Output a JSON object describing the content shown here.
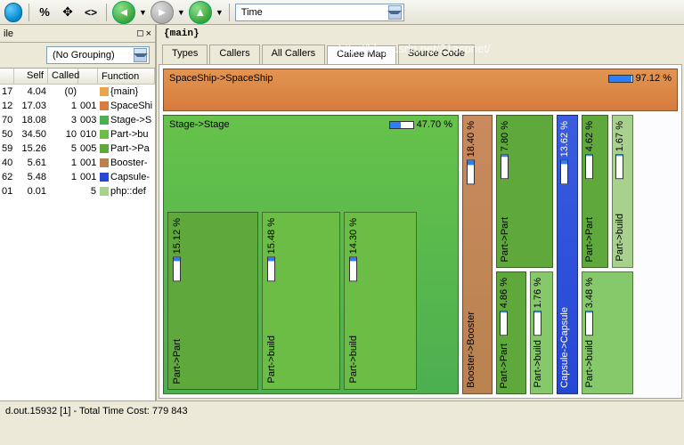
{
  "toolbar": {
    "combo_label": "Time"
  },
  "left": {
    "title": "ile",
    "grouping": "(No Grouping)",
    "headers": [
      "",
      "Self",
      "Called",
      "",
      "Function"
    ],
    "rows": [
      {
        "a": "17",
        "self": "4.04",
        "called": "(0)",
        "n": "",
        "color": "#e8a54a",
        "fn": "{main}"
      },
      {
        "a": "12",
        "self": "17.03",
        "called": "1",
        "n": "001",
        "color": "#d77b3f",
        "fn": "SpaceShi"
      },
      {
        "a": "70",
        "self": "18.08",
        "called": "3",
        "n": "003",
        "color": "#4caf50",
        "fn": "Stage->S"
      },
      {
        "a": "50",
        "self": "34.50",
        "called": "10",
        "n": "010",
        "color": "#6bbd45",
        "fn": "Part->bu"
      },
      {
        "a": "59",
        "self": "15.26",
        "called": "5",
        "n": "005",
        "color": "#5fa93c",
        "fn": "Part->Pa"
      },
      {
        "a": "40",
        "self": "5.61",
        "called": "1",
        "n": "001",
        "color": "#b9824f",
        "fn": "Booster-"
      },
      {
        "a": "62",
        "self": "5.48",
        "called": "1",
        "n": "001",
        "color": "#2547d4",
        "fn": "Capsule-"
      },
      {
        "a": "01",
        "self": "0.01",
        "called": "",
        "n": "5",
        "color": "#a9d18e",
        "fn": "php::def"
      }
    ]
  },
  "right": {
    "breadcrumb": "{main}",
    "tabs": [
      "Types",
      "Callers",
      "All Callers",
      "Callee Map",
      "Source Code"
    ],
    "active_tab": 3
  },
  "watermark": "http://blog.csdn.net/21aspnet/",
  "tm": {
    "spaceship": {
      "label": "SpaceShip->SpaceShip",
      "pct": "97.12 %"
    },
    "stage": {
      "label": "Stage->Stage",
      "pct": "47.70 %"
    },
    "n1": {
      "label": "Part->Part",
      "pct": "15.12 %"
    },
    "n2": {
      "label": "Part->build",
      "pct": "15.48 %"
    },
    "n3": {
      "label": "Part->build",
      "pct": "14.30 %"
    },
    "booster": {
      "label": "Booster->Booster",
      "pct": "18.40 %"
    },
    "b1": {
      "label": "Part->Part",
      "pct": "7.80 %"
    },
    "b2": {
      "label": "Part->Part",
      "pct": "4.86 %"
    },
    "b3": {
      "label": "Part->build",
      "pct": "1.76 %"
    },
    "capsule": {
      "label": "Capsule->Capsule",
      "pct": "13.62 %"
    },
    "c1": {
      "label": "Part->Part",
      "pct": "4.62 %"
    },
    "c2": {
      "label": "Part->build",
      "pct": "1.67 %"
    },
    "c3": {
      "label": "Part->build",
      "pct": "3.48 %"
    }
  },
  "status": "d.out.15932 [1] - Total Time Cost: 779 843"
}
